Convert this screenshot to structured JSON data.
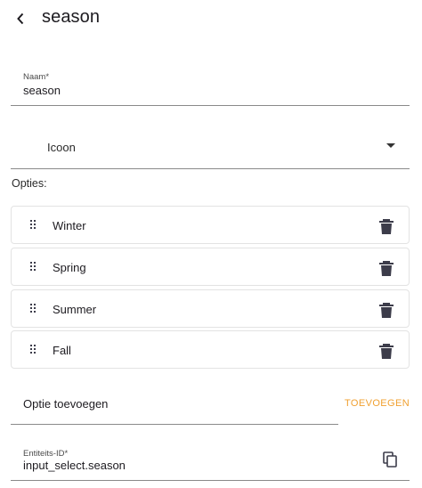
{
  "header": {
    "title": "season",
    "back_icon": "chevron-left-icon"
  },
  "name_field": {
    "label": "Naam*",
    "value": "season"
  },
  "icon_field": {
    "placeholder": "Icoon",
    "dropdown_icon": "caret-down-icon"
  },
  "options": {
    "label": "Opties:",
    "items": [
      {
        "label": "Winter"
      },
      {
        "label": "Spring"
      },
      {
        "label": "Summer"
      },
      {
        "label": "Fall"
      }
    ],
    "drag_icon": "drag-handle-icon",
    "delete_icon": "trash-icon"
  },
  "add_option": {
    "placeholder": "Optie toevoegen",
    "button_label": "TOEVOEGEN"
  },
  "entity_field": {
    "label": "Entiteits-ID*",
    "value": "input_select.season",
    "copy_icon": "copy-icon"
  },
  "colors": {
    "accent": "#f0a030",
    "text": "#1d1b20",
    "border": "#e3e3e3",
    "icon": "#3c3c4a"
  }
}
